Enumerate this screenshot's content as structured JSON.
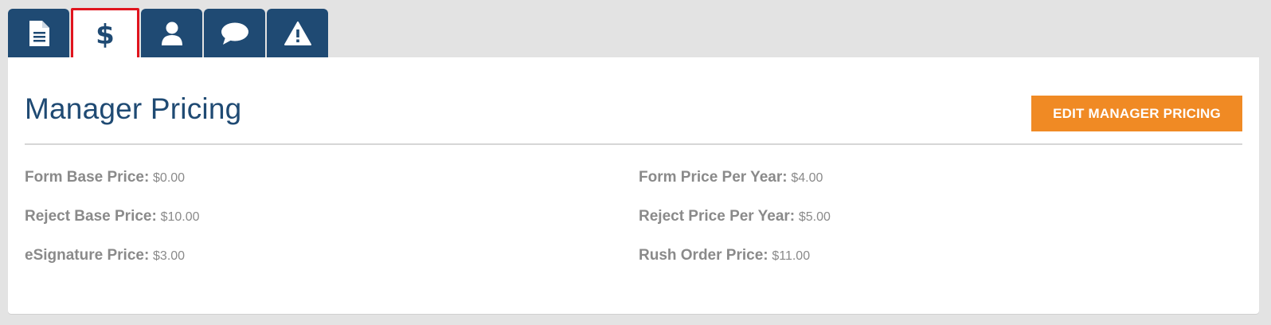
{
  "tabs": [
    {
      "icon": "document-icon",
      "active": false
    },
    {
      "icon": "dollar-icon",
      "active": true,
      "label": "$"
    },
    {
      "icon": "user-icon",
      "active": false
    },
    {
      "icon": "chat-bubble-icon",
      "active": false
    },
    {
      "icon": "warning-icon",
      "active": false
    }
  ],
  "panel": {
    "title": "Manager Pricing",
    "edit_button_label": "EDIT MANAGER PRICING",
    "fields_left": [
      {
        "label": "Form Base Price:",
        "value": "$0.00"
      },
      {
        "label": "Reject Base Price:",
        "value": "$10.00"
      },
      {
        "label": "eSignature Price:",
        "value": "$3.00"
      }
    ],
    "fields_right": [
      {
        "label": "Form Price Per Year:",
        "value": "$4.00"
      },
      {
        "label": "Reject Price Per Year:",
        "value": "$5.00"
      },
      {
        "label": "Rush Order Price:",
        "value": "$11.00"
      }
    ]
  },
  "colors": {
    "tab_bg": "#1f4a73",
    "active_tab_border": "#e0141e",
    "button_bg": "#f08a24",
    "title": "#1f4a73",
    "field_text": "#8a8a8a"
  }
}
